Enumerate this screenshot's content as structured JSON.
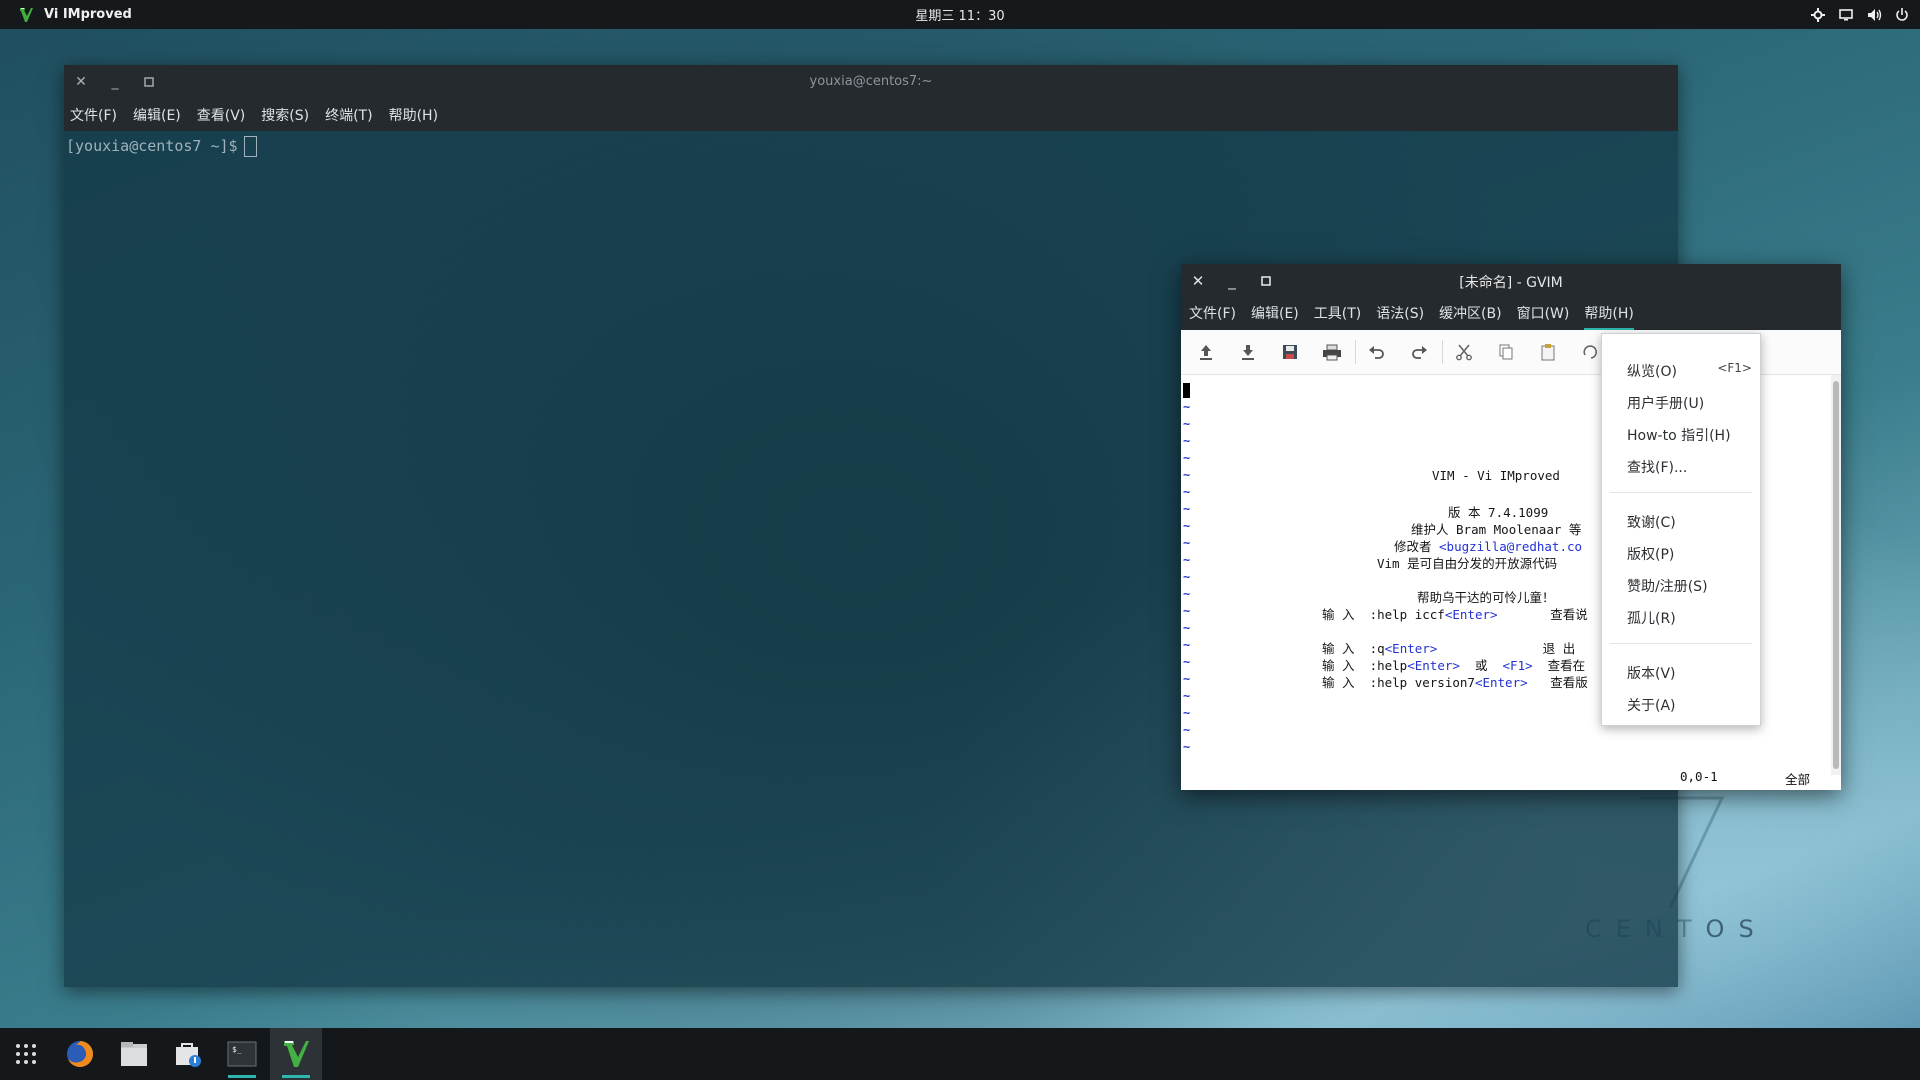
{
  "top_panel": {
    "app_name": "Vi IMproved",
    "clock": "星期三 11：30",
    "tray_icons": [
      "settings-icon",
      "display-icon",
      "volume-icon",
      "power-icon"
    ]
  },
  "terminal": {
    "title": "youxia@centos7:~",
    "menu": [
      "文件(F)",
      "编辑(E)",
      "查看(V)",
      "搜索(S)",
      "终端(T)",
      "帮助(H)"
    ],
    "prompt": "[youxia@centos7 ~]$"
  },
  "gvim": {
    "title": "[未命名] - GVIM",
    "menu": [
      "文件(F)",
      "编辑(E)",
      "工具(T)",
      "语法(S)",
      "缓冲区(B)",
      "窗口(W)",
      "帮助(H)"
    ],
    "active_menu": "帮助(H)",
    "toolbar_icons": [
      "open-icon",
      "save-down-icon",
      "save-icon",
      "print-icon",
      "undo-icon",
      "redo-icon",
      "cut-icon",
      "copy-icon",
      "paste-icon",
      "replace-icon",
      "script-icon"
    ],
    "intro": {
      "l1": "VIM - Vi IMproved",
      "l2": "版 本 7.4.1099",
      "l3": "维护人 Bram Moolenaar 等",
      "l4a": "修改者 ",
      "l4b": "<bugzilla@redhat.co",
      "l5": "Vim 是可自由分发的开放源代码",
      "l6": "帮助乌干达的可怜儿童！",
      "l7a": "输 入  :help iccf",
      "l7b": "<Enter>",
      "l7c": "       查看说",
      "l8a": "输 入  :q",
      "l8b": "<Enter>",
      "l8c": "              退 出",
      "l9a": "输 入  :help",
      "l9b": "<Enter>",
      "l9c": "  或  ",
      "l9d": "<F1>",
      "l9e": "  查看在",
      "l10a": "输 入  :help version7",
      "l10b": "<Enter>",
      "l10c": "   查看版"
    },
    "status_pos": "0,0-1",
    "status_all": "全部"
  },
  "help_menu": {
    "items": [
      {
        "label": "纵览(O)",
        "accel": "<F1>"
      },
      {
        "label": "用户手册(U)"
      },
      {
        "label": "How-to 指引(H)"
      },
      {
        "label": "查找(F)..."
      },
      {
        "label": "致谢(C)"
      },
      {
        "label": "版权(P)"
      },
      {
        "label": "赞助/注册(S)"
      },
      {
        "label": "孤儿(R)"
      },
      {
        "label": "版本(V)"
      },
      {
        "label": "关于(A)"
      }
    ]
  },
  "watermark": {
    "prefix": "CENT",
    "suffix": "OS"
  },
  "dock": {
    "items": [
      "apps-grid-icon",
      "firefox-icon",
      "files-icon",
      "software-icon",
      "terminal-icon",
      "vim-icon"
    ]
  },
  "colors": {
    "accent": "#2eb5ad",
    "panel": "#16191c",
    "titlebar": "#252a2e"
  }
}
